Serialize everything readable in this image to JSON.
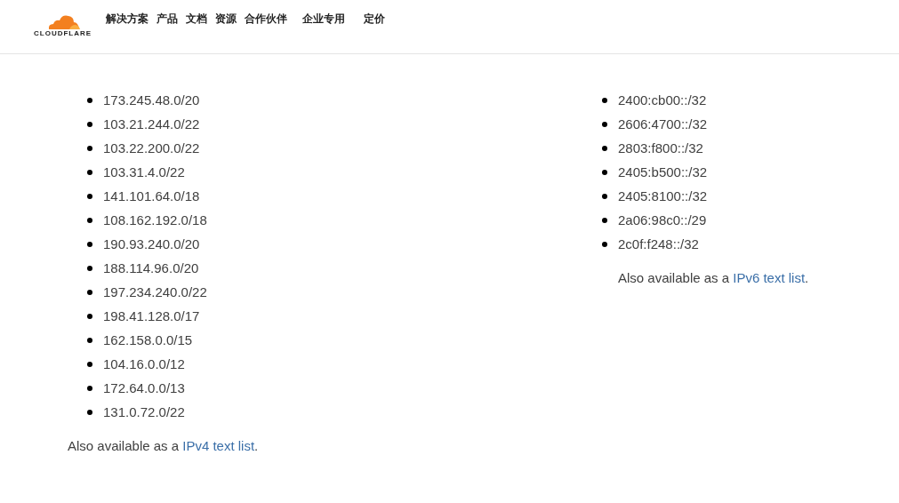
{
  "header": {
    "logo_text": "CLOUDFLARE",
    "nav": [
      {
        "label": "解决方案"
      },
      {
        "label": "产品"
      },
      {
        "label": "文档"
      },
      {
        "label": "资源"
      },
      {
        "label": "合作伙伴"
      },
      {
        "label": "企业专用"
      },
      {
        "label": "定价"
      }
    ]
  },
  "columns": [
    {
      "ranges": [
        "173.245.48.0/20",
        "103.21.244.0/22",
        "103.22.200.0/22",
        "103.31.4.0/22",
        "141.101.64.0/18",
        "108.162.192.0/18",
        "190.93.240.0/20",
        "188.114.96.0/20",
        "197.234.240.0/22",
        "198.41.128.0/17",
        "162.158.0.0/15",
        "104.16.0.0/12",
        "172.64.0.0/13",
        "131.0.72.0/22"
      ],
      "note": {
        "text": "Also available as a ",
        "link": "IPv4 text list",
        "end": "."
      },
      "note_indented": false
    },
    {
      "ranges": [
        "2400:cb00::/32",
        "2606:4700::/32",
        "2803:f800::/32",
        "2405:b500::/32",
        "2405:8100::/32",
        "2a06:98c0::/29",
        "2c0f:f248::/32"
      ],
      "note": {
        "text": "Also available as a ",
        "link": "IPv6 text list",
        "end": "."
      },
      "note_indented": true
    }
  ]
}
